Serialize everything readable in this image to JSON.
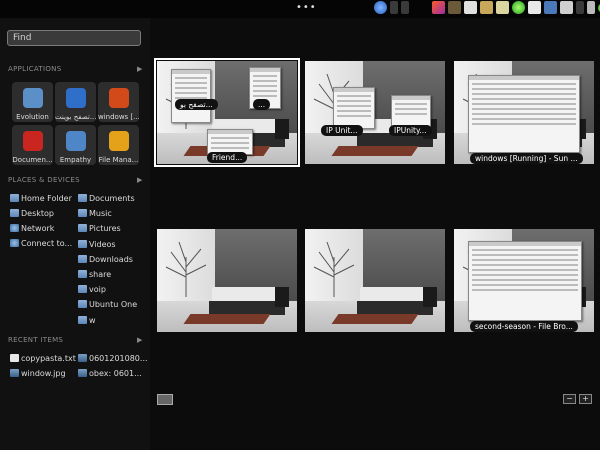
{
  "topbar": {
    "menu_dots": "•••",
    "tray_icons": [
      "app-swirl-icon",
      "applet-icon",
      "bluetooth-icon",
      "pencil-icon",
      "notes-icon",
      "paste-icon",
      "folder-icon",
      "image-icon",
      "network-green-icon",
      "mail-icon",
      "monitor-icon",
      "network-icon",
      "chat-icon",
      "volume-icon",
      "status-green-icon",
      "user-icon"
    ]
  },
  "search": {
    "placeholder": "Find"
  },
  "applications": {
    "header": "APPLICATIONS",
    "items": [
      {
        "label": "Evolution",
        "icon": "evolution-icon",
        "color": "#5a8fc8"
      },
      {
        "label": "تصفح بوينت...",
        "icon": "globe-icon",
        "color": "#2f6ec9"
      },
      {
        "label": "windows [...",
        "icon": "windows-xp-icon",
        "color": "#d24a1a"
      },
      {
        "label": "Documen...",
        "icon": "document-viewer-icon",
        "color": "#c8261e"
      },
      {
        "label": "Empathy",
        "icon": "empathy-icon",
        "color": "#4f86c8"
      },
      {
        "label": "File Mana...",
        "icon": "file-manager-icon",
        "color": "#e3a21a"
      }
    ]
  },
  "places": {
    "header": "PLACES & DEVICES",
    "left": [
      {
        "label": "Home Folder",
        "icon": "folder"
      },
      {
        "label": "Desktop",
        "icon": "folder"
      },
      {
        "label": "Network",
        "icon": "net"
      },
      {
        "label": "Connect to...",
        "icon": "net"
      }
    ],
    "right": [
      {
        "label": "Documents",
        "icon": "folder"
      },
      {
        "label": "Music",
        "icon": "folder"
      },
      {
        "label": "Pictures",
        "icon": "folder"
      },
      {
        "label": "Videos",
        "icon": "folder"
      },
      {
        "label": "Downloads",
        "icon": "folder"
      },
      {
        "label": "share",
        "icon": "folder"
      },
      {
        "label": "voip",
        "icon": "folder"
      },
      {
        "label": "Ubuntu One",
        "icon": "folder"
      },
      {
        "label": "w",
        "icon": "folder"
      }
    ]
  },
  "recent": {
    "header": "RECENT ITEMS",
    "left": [
      {
        "label": "copypasta.txt",
        "icon": "doc"
      },
      {
        "label": "window.jpg",
        "icon": "imgic"
      }
    ],
    "right": [
      {
        "label": "0601201080...",
        "icon": "imgic"
      },
      {
        "label": "obex: 0601...",
        "icon": "imgic"
      }
    ]
  },
  "workspaces": [
    {
      "labels": [
        "تصفح بو...",
        "...",
        "Friend..."
      ],
      "selected": true
    },
    {
      "labels": [
        "IP Unit...",
        "IPUnity..."
      ],
      "selected": false
    },
    {
      "labels": [
        "windows [Running] - Sun ..."
      ],
      "selected": false
    },
    {
      "labels": [],
      "selected": false
    },
    {
      "labels": [],
      "selected": false
    },
    {
      "labels": [
        "second-season - File Bro..."
      ],
      "selected": false
    }
  ],
  "controls": {
    "minus": "−",
    "plus": "+"
  }
}
